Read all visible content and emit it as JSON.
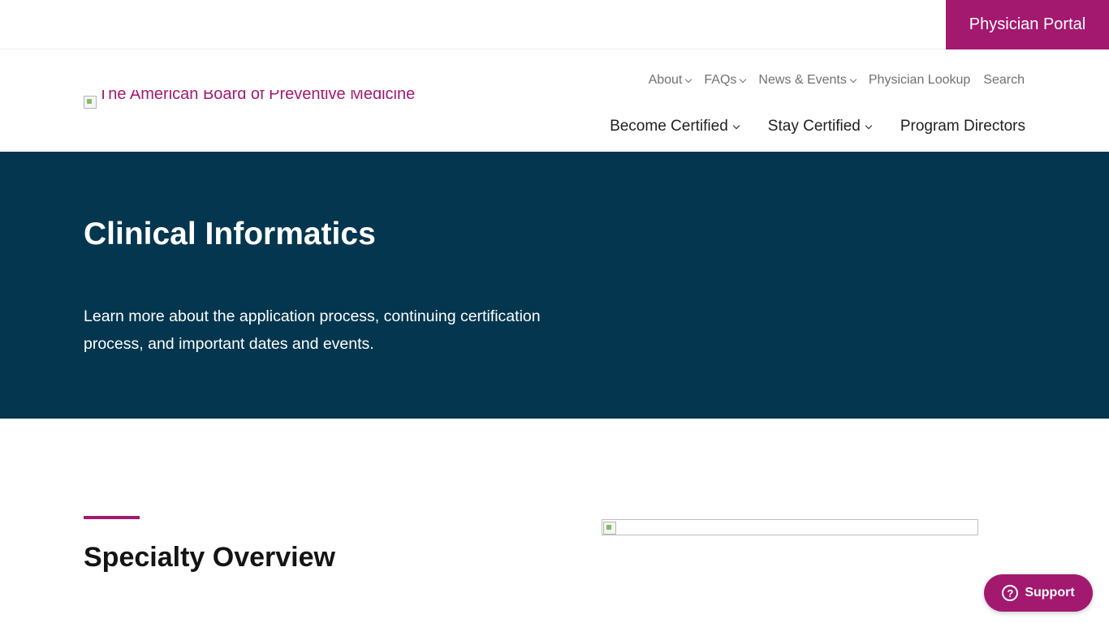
{
  "topbar": {
    "portal_label": "Physician Portal"
  },
  "header": {
    "logo_alt": "The American Board of Preventive Medicine",
    "utility_nav": [
      {
        "label": "About",
        "has_dropdown": true
      },
      {
        "label": "FAQs",
        "has_dropdown": true
      },
      {
        "label": "News & Events",
        "has_dropdown": true
      },
      {
        "label": "Physician Lookup",
        "has_dropdown": false
      },
      {
        "label": "Search",
        "has_dropdown": false
      }
    ],
    "main_nav": [
      {
        "label": "Become Certified",
        "has_dropdown": true
      },
      {
        "label": "Stay Certified",
        "has_dropdown": true
      },
      {
        "label": "Program Directors",
        "has_dropdown": false
      }
    ]
  },
  "hero": {
    "title": "Clinical Informatics",
    "description": "Learn more about the application process, continuing certification process, and important dates and events."
  },
  "overview": {
    "title": "Specialty Overview"
  },
  "support": {
    "label": "Support"
  },
  "colors": {
    "brand": "#a3196f",
    "hero_bg": "#04364f"
  }
}
